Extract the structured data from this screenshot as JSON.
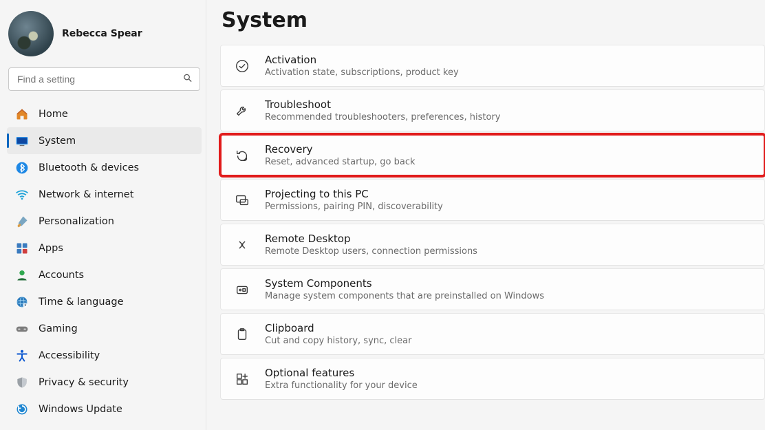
{
  "user": {
    "name": "Rebecca Spear"
  },
  "search": {
    "placeholder": "Find a setting"
  },
  "sidebar": {
    "items": [
      {
        "label": "Home",
        "icon": "home",
        "selected": false
      },
      {
        "label": "System",
        "icon": "system",
        "selected": true
      },
      {
        "label": "Bluetooth & devices",
        "icon": "bluetooth",
        "selected": false
      },
      {
        "label": "Network & internet",
        "icon": "wifi",
        "selected": false
      },
      {
        "label": "Personalization",
        "icon": "brush",
        "selected": false
      },
      {
        "label": "Apps",
        "icon": "apps",
        "selected": false
      },
      {
        "label": "Accounts",
        "icon": "person",
        "selected": false
      },
      {
        "label": "Time & language",
        "icon": "globe",
        "selected": false
      },
      {
        "label": "Gaming",
        "icon": "gamepad",
        "selected": false
      },
      {
        "label": "Accessibility",
        "icon": "accessibility",
        "selected": false
      },
      {
        "label": "Privacy & security",
        "icon": "shield",
        "selected": false
      },
      {
        "label": "Windows Update",
        "icon": "update",
        "selected": false
      }
    ]
  },
  "page": {
    "title": "System"
  },
  "settings": [
    {
      "icon": "check",
      "title": "Activation",
      "sub": "Activation state, subscriptions, product key",
      "highlight": false
    },
    {
      "icon": "wrench",
      "title": "Troubleshoot",
      "sub": "Recommended troubleshooters, preferences, history",
      "highlight": false
    },
    {
      "icon": "recovery",
      "title": "Recovery",
      "sub": "Reset, advanced startup, go back",
      "highlight": true
    },
    {
      "icon": "project",
      "title": "Projecting to this PC",
      "sub": "Permissions, pairing PIN, discoverability",
      "highlight": false
    },
    {
      "icon": "remote",
      "title": "Remote Desktop",
      "sub": "Remote Desktop users, connection permissions",
      "highlight": false
    },
    {
      "icon": "components",
      "title": "System Components",
      "sub": "Manage system components that are preinstalled on Windows",
      "highlight": false
    },
    {
      "icon": "clipboard",
      "title": "Clipboard",
      "sub": "Cut and copy history, sync, clear",
      "highlight": false
    },
    {
      "icon": "features",
      "title": "Optional features",
      "sub": "Extra functionality for your device",
      "highlight": false
    }
  ]
}
